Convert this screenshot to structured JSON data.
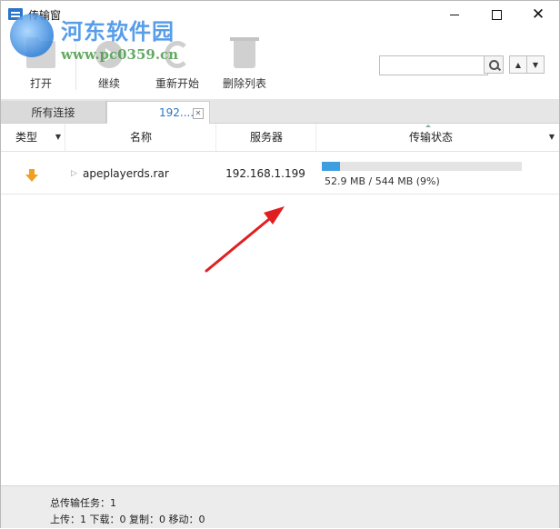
{
  "window": {
    "title": "传输窗"
  },
  "watermark": {
    "title": "河东软件园",
    "url": "www.pc0359.cn"
  },
  "toolbar": {
    "open_label": "打开",
    "continue_label": "继续",
    "restart_label": "重新开始",
    "delete_list_label": "删除列表"
  },
  "search": {
    "placeholder": "",
    "value": ""
  },
  "tabs": [
    {
      "label": "所有连接",
      "active": false
    },
    {
      "label": "192....",
      "active": true
    }
  ],
  "columns": {
    "type": "类型",
    "name": "名称",
    "server": "服务器",
    "status": "传输状态"
  },
  "transfers": [
    {
      "direction_icon": "download-arrow-icon",
      "name": "apeplayerds.rar",
      "server": "192.168.1.199",
      "progress_fraction": 0.09,
      "progress_text": "52.9 MB / 544 MB (9%)"
    }
  ],
  "status_bar": {
    "total_label": "总传输任务：1",
    "counts_label": "上传：1 下载：0 复制：0 移动：0"
  },
  "colors": {
    "accent": "#2a74c9",
    "progress": "#3d9ee0",
    "download_icon": "#f0a020",
    "annotation_arrow": "#e02020"
  }
}
